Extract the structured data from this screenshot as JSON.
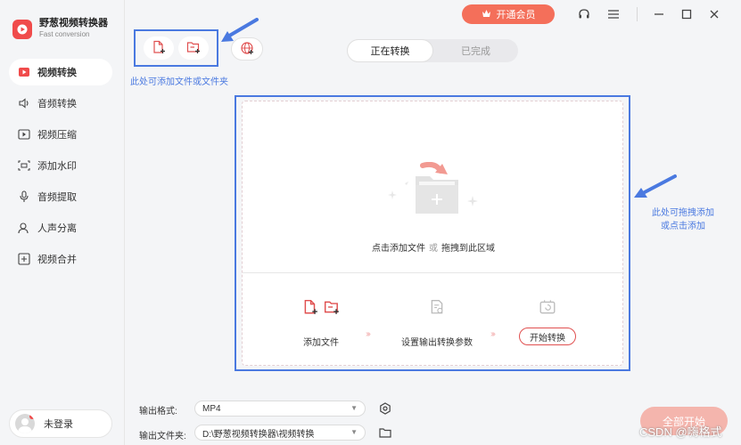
{
  "app": {
    "title": "野葱视频转换器",
    "subtitle": "Fast conversion",
    "brand_color": "#f04b4b"
  },
  "sidebar": {
    "items": [
      {
        "label": "视频转换",
        "icon": "video-convert-icon",
        "active": true
      },
      {
        "label": "音频转换",
        "icon": "audio-convert-icon",
        "active": false
      },
      {
        "label": "视频压缩",
        "icon": "video-compress-icon",
        "active": false
      },
      {
        "label": "添加水印",
        "icon": "watermark-icon",
        "active": false
      },
      {
        "label": "音频提取",
        "icon": "audio-extract-icon",
        "active": false
      },
      {
        "label": "人声分离",
        "icon": "vocal-separate-icon",
        "active": false
      },
      {
        "label": "视频合并",
        "icon": "video-merge-icon",
        "active": false
      }
    ],
    "user": {
      "label": "未登录"
    }
  },
  "titlebar": {
    "vip_label": "开通会员",
    "vip_color": "#f46f5a"
  },
  "toolbar": {
    "hint_top": "此处可添加文件或文件夹",
    "hint_right_line1": "此处可拖拽添加",
    "hint_right_line2": "或点击添加",
    "annotation_color": "#4a79e0"
  },
  "tabs": [
    {
      "label": "正在转换",
      "active": true
    },
    {
      "label": "已完成",
      "active": false
    }
  ],
  "dropzone": {
    "title_a": "点击添加文件",
    "title_or": "或",
    "title_b": "拖拽到此区域",
    "steps": [
      {
        "label": "添加文件"
      },
      {
        "label": "设置输出转换参数"
      },
      {
        "label": "开始转换"
      }
    ]
  },
  "output": {
    "format_label": "输出格式:",
    "format_value": "MP4",
    "folder_label": "输出文件夹:",
    "folder_value": "D:\\野葱视频转换器\\视频转换"
  },
  "actions": {
    "start_all_label": "全部开始"
  },
  "watermark": "CSDN @嗨格式"
}
